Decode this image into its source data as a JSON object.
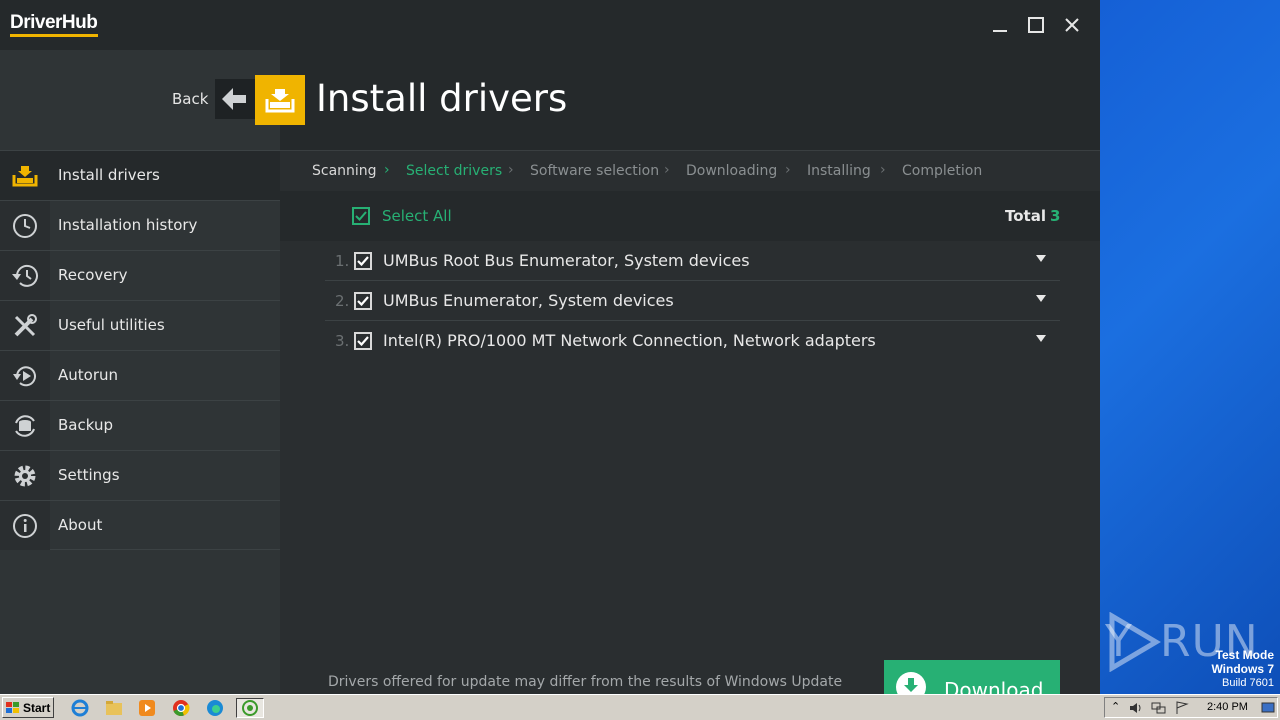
{
  "app": {
    "logo": "DriverHub",
    "page_title": "Install drivers",
    "back_label": "Back"
  },
  "sidebar": {
    "items": [
      {
        "label": "Install drivers",
        "icon": "install-drivers-icon",
        "active": true
      },
      {
        "label": "Installation history",
        "icon": "clock-icon"
      },
      {
        "label": "Recovery",
        "icon": "recovery-icon"
      },
      {
        "label": "Useful utilities",
        "icon": "tools-icon"
      },
      {
        "label": "Autorun",
        "icon": "autorun-icon"
      },
      {
        "label": "Backup",
        "icon": "backup-icon"
      },
      {
        "label": "Settings",
        "icon": "gear-icon"
      },
      {
        "label": "About",
        "icon": "info-icon"
      }
    ]
  },
  "steps": {
    "items": [
      "Scanning",
      "Select drivers",
      "Software selection",
      "Downloading",
      "Installing",
      "Completion"
    ],
    "current": "Select drivers"
  },
  "selection": {
    "select_all_label": "Select All",
    "select_all_checked": true,
    "total_label": "Total",
    "total_value": "3"
  },
  "drivers": [
    {
      "num": "1.",
      "name": "UMBus Root Bus Enumerator, System devices",
      "checked": true
    },
    {
      "num": "2.",
      "name": "UMBus Enumerator, System devices",
      "checked": true
    },
    {
      "num": "3.",
      "name": "Intel(R) PRO/1000 MT Network Connection, Network adapters",
      "checked": true
    }
  ],
  "footer": {
    "disclaimer": "Drivers offered for update may differ from the results of Windows Update",
    "download_label": "Download"
  },
  "desktop": {
    "watermark": "ANY RUN",
    "test_mode": "Test Mode",
    "os": "Windows 7",
    "build": "Build 7601"
  },
  "taskbar": {
    "start_label": "Start",
    "apps": [
      "ie-icon",
      "explorer-folder-icon",
      "media-player-icon",
      "chrome-icon",
      "edge-icon",
      "driverhub-taskbar-icon"
    ],
    "clock": "2:40 PM"
  },
  "colors": {
    "accent_green": "#27b074",
    "accent_yellow": "#f0b400",
    "window_bg": "#25292b",
    "sidebar_bg": "#2f3436"
  }
}
